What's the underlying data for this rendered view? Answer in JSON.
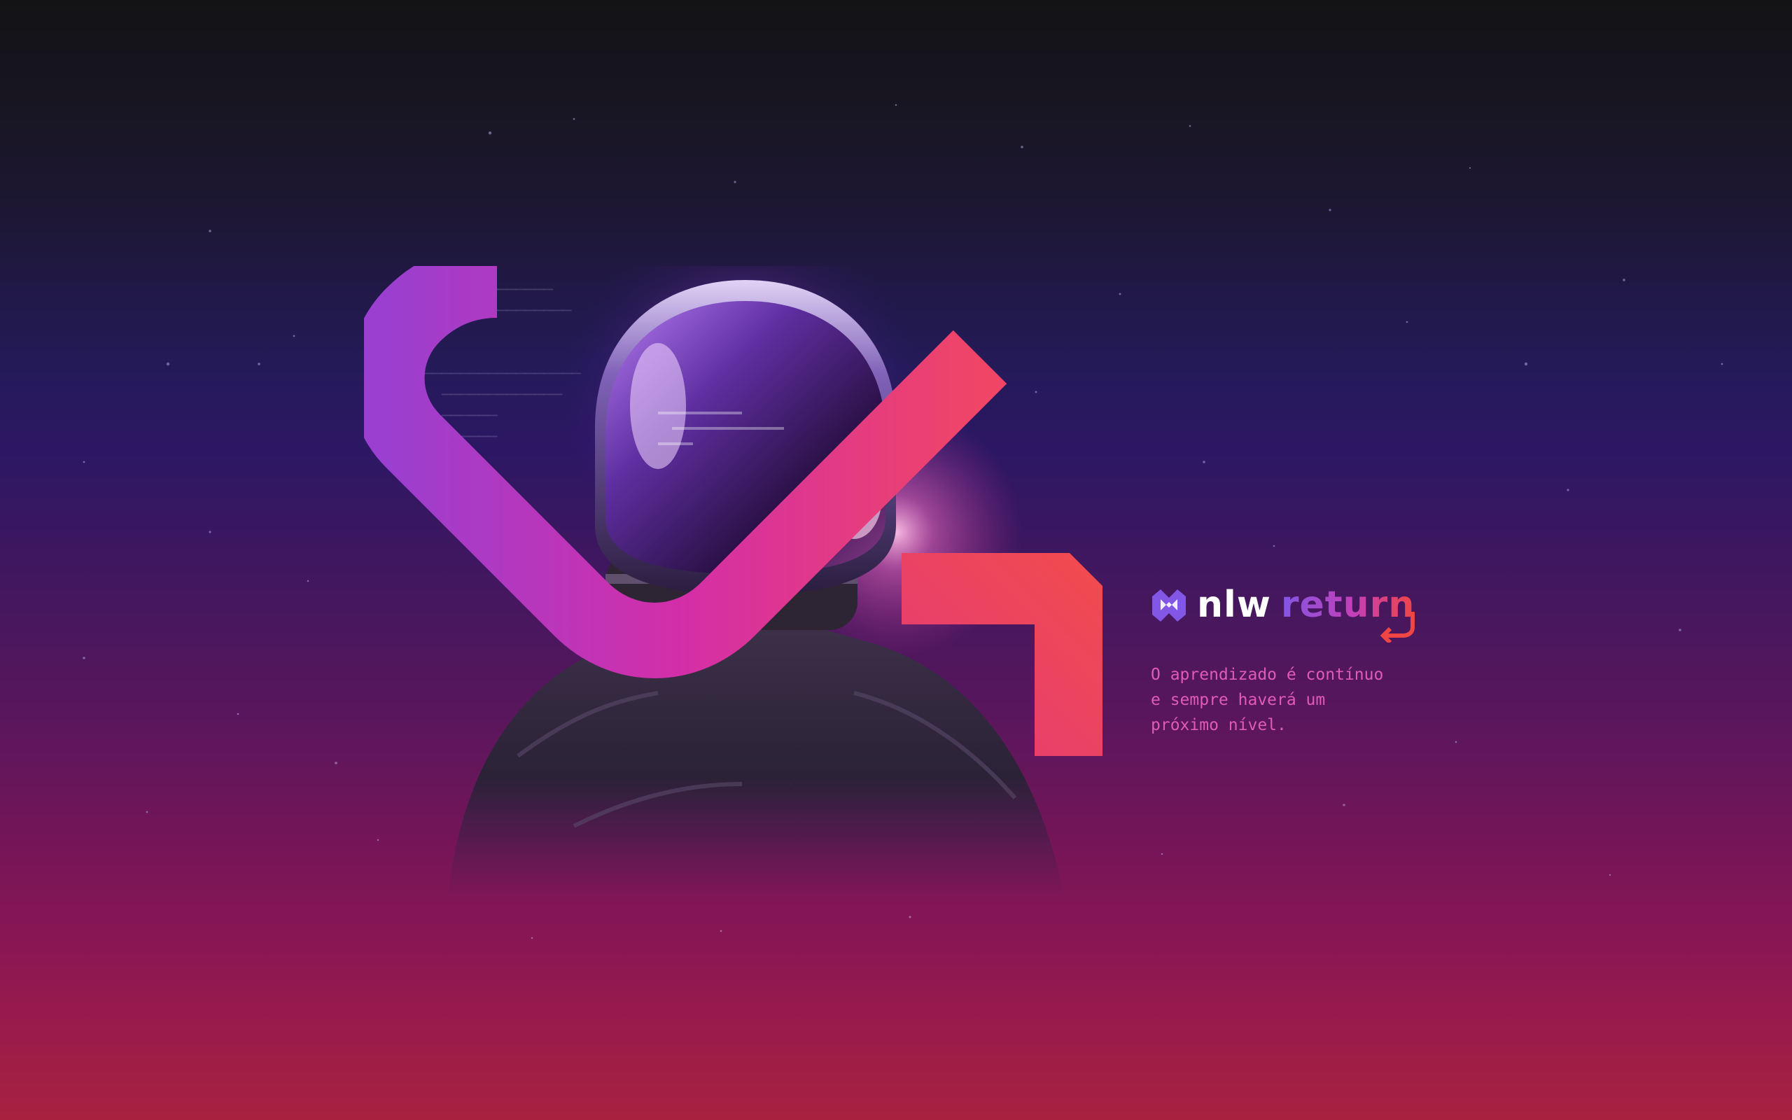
{
  "brand": {
    "name_main": "nlw",
    "name_accent": "return",
    "logo_icon": "nlw-rocketseat-logo-icon",
    "accent_gradient": [
      "#8257e5",
      "#c43fb8",
      "#f04545"
    ]
  },
  "tagline": {
    "line1": "O aprendizado é contínuo",
    "line2": "e sempre haverá um",
    "line3": "próximo nível."
  },
  "hero": {
    "figure": "astronaut-helmet",
    "symbol": "return-arrow-icon"
  }
}
